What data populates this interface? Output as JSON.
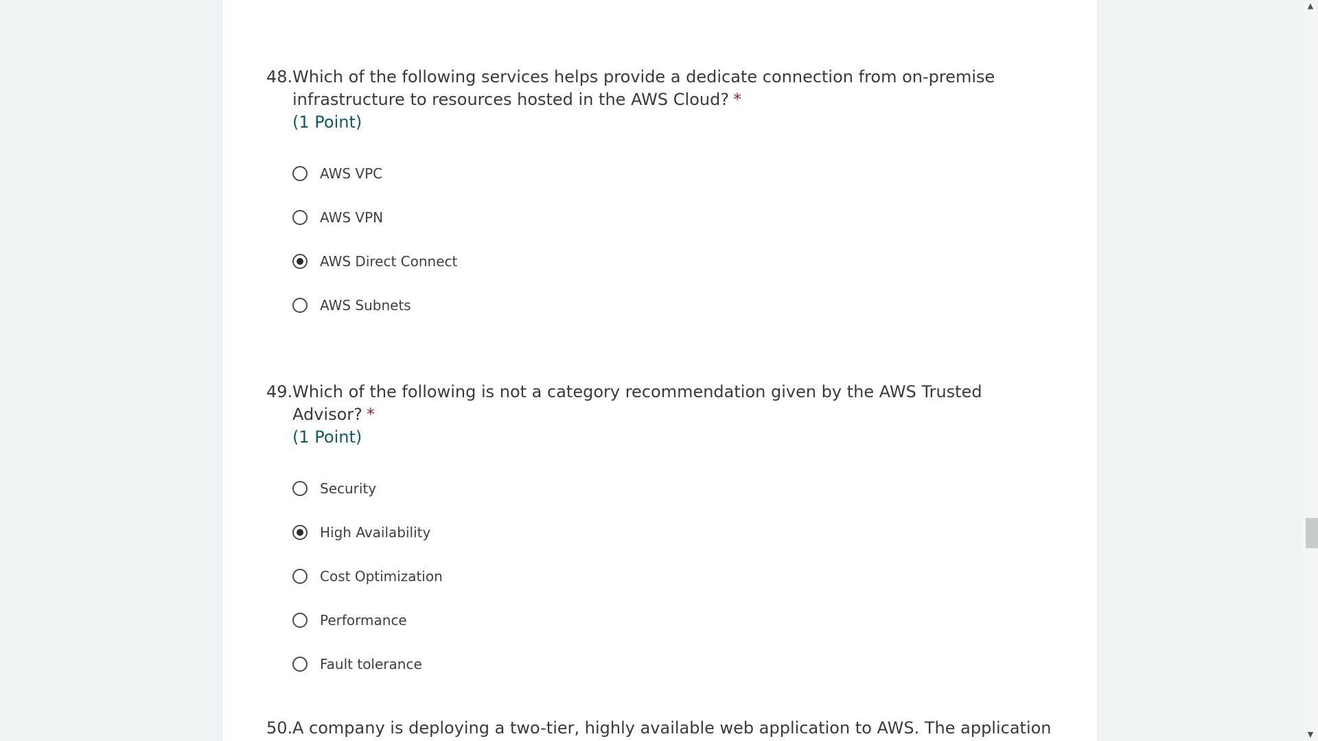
{
  "questions": [
    {
      "number": "48.",
      "text_line1": "Which of the following services helps provide a dedicate connection from on-premise",
      "text_line2": "infrastructure to resources hosted in the AWS Cloud?",
      "required_marker": "*",
      "points": "(1 Point)",
      "options": [
        {
          "label": "AWS VPC",
          "selected": false
        },
        {
          "label": "AWS VPN",
          "selected": false
        },
        {
          "label": "AWS Direct Connect",
          "selected": true
        },
        {
          "label": "AWS Subnets",
          "selected": false
        }
      ]
    },
    {
      "number": "49.",
      "text": "Which of the following is not a category recommendation given by the AWS Trusted Advisor?",
      "required_marker": "*",
      "points": "(1 Point)",
      "options": [
        {
          "label": "Security",
          "selected": false
        },
        {
          "label": "High Availability",
          "selected": true
        },
        {
          "label": "Cost Optimization",
          "selected": false
        },
        {
          "label": "Performance",
          "selected": false
        },
        {
          "label": "Fault tolerance",
          "selected": false
        }
      ]
    },
    {
      "number": "50.",
      "text": "A company is deploying a two-tier, highly available web application to AWS. The application"
    }
  ],
  "scrollbar": {
    "up_icon": "chevron-up-icon",
    "down_icon": "chevron-down-icon"
  },
  "colors": {
    "background": "#eef3f4",
    "card": "#ffffff",
    "required": "#a4262c",
    "points": "#0f5c63"
  }
}
